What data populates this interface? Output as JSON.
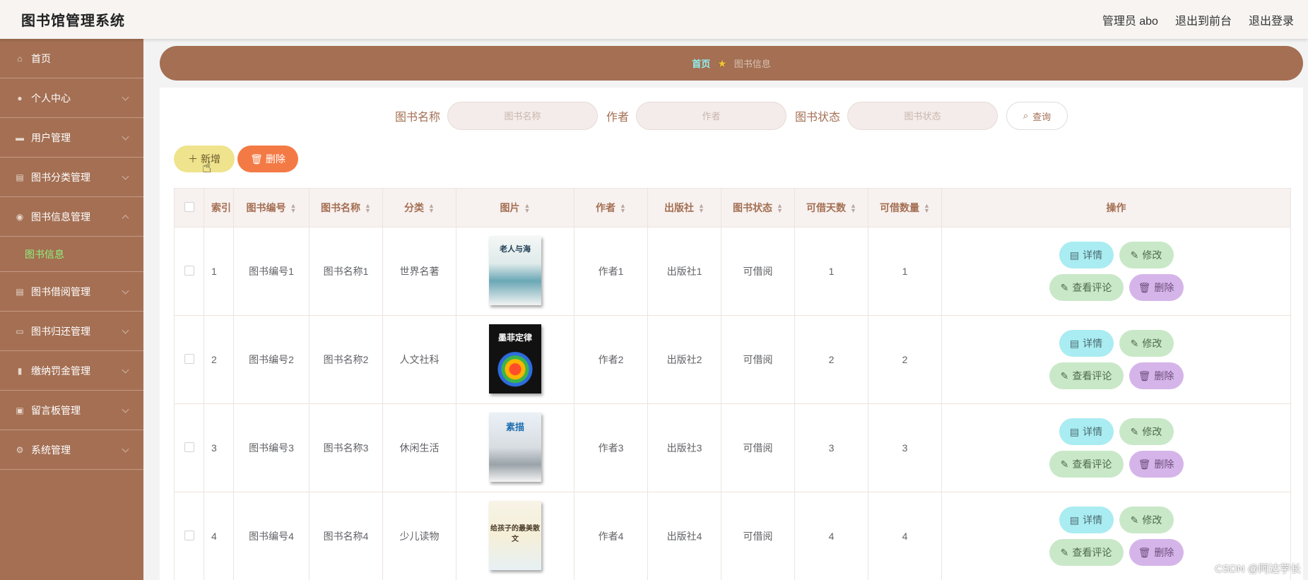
{
  "header": {
    "app_title": "图书馆管理系统",
    "admin_label": "管理员 abo",
    "exit_frontend": "退出到前台",
    "logout": "退出登录"
  },
  "sidebar": {
    "items": [
      {
        "label": "首页",
        "icon": "home-icon"
      },
      {
        "label": "个人中心",
        "icon": "user-icon"
      },
      {
        "label": "用户管理",
        "icon": "briefcase-icon"
      },
      {
        "label": "图书分类管理",
        "icon": "clipboard-icon"
      },
      {
        "label": "图书信息管理",
        "icon": "location-icon",
        "expanded": true
      },
      {
        "label": "图书借阅管理",
        "icon": "clipboard-icon"
      },
      {
        "label": "图书归还管理",
        "icon": "chat-icon"
      },
      {
        "label": "缴纳罚金管理",
        "icon": "bar-chart-icon"
      },
      {
        "label": "留言板管理",
        "icon": "monitor-icon"
      },
      {
        "label": "系统管理",
        "icon": "gear-icon"
      }
    ],
    "active_sub": "图书信息"
  },
  "breadcrumb": {
    "home": "首页",
    "current": "图书信息"
  },
  "search": {
    "name_label": "图书名称",
    "name_placeholder": "图书名称",
    "author_label": "作者",
    "author_placeholder": "作者",
    "status_label": "图书状态",
    "status_placeholder": "图书状态",
    "button": "查询"
  },
  "actions": {
    "add": "新增",
    "delete": "删除"
  },
  "table": {
    "columns": [
      "索引",
      "图书编号",
      "图书名称",
      "分类",
      "图片",
      "作者",
      "出版社",
      "图书状态",
      "可借天数",
      "可借数量",
      "操作"
    ],
    "rows": [
      {
        "index": "1",
        "code": "图书编号1",
        "name": "图书名称1",
        "category": "世界名著",
        "cover_title": "老人与海",
        "author": "作者1",
        "publisher": "出版社1",
        "status": "可借阅",
        "days": "1",
        "qty": "1"
      },
      {
        "index": "2",
        "code": "图书编号2",
        "name": "图书名称2",
        "category": "人文社科",
        "cover_title": "墨菲定律",
        "author": "作者2",
        "publisher": "出版社2",
        "status": "可借阅",
        "days": "2",
        "qty": "2"
      },
      {
        "index": "3",
        "code": "图书编号3",
        "name": "图书名称3",
        "category": "休闲生活",
        "cover_title": "素描",
        "author": "作者3",
        "publisher": "出版社3",
        "status": "可借阅",
        "days": "3",
        "qty": "3"
      },
      {
        "index": "4",
        "code": "图书编号4",
        "name": "图书名称4",
        "category": "少儿读物",
        "cover_title": "给孩子的最美散文",
        "author": "作者4",
        "publisher": "出版社4",
        "status": "可借阅",
        "days": "4",
        "qty": "4"
      }
    ],
    "op_labels": {
      "detail": "详情",
      "edit": "修改",
      "comments": "查看评论",
      "delete": "删除"
    }
  },
  "watermark": "CSDN @阿达学长",
  "colors": {
    "sidebar_bg": "#a46f53",
    "active_sub": "#8ff27a",
    "breadcrumb_home": "#8ff2f0",
    "add_button": "#efe38d",
    "delete_button": "#f47a45"
  }
}
